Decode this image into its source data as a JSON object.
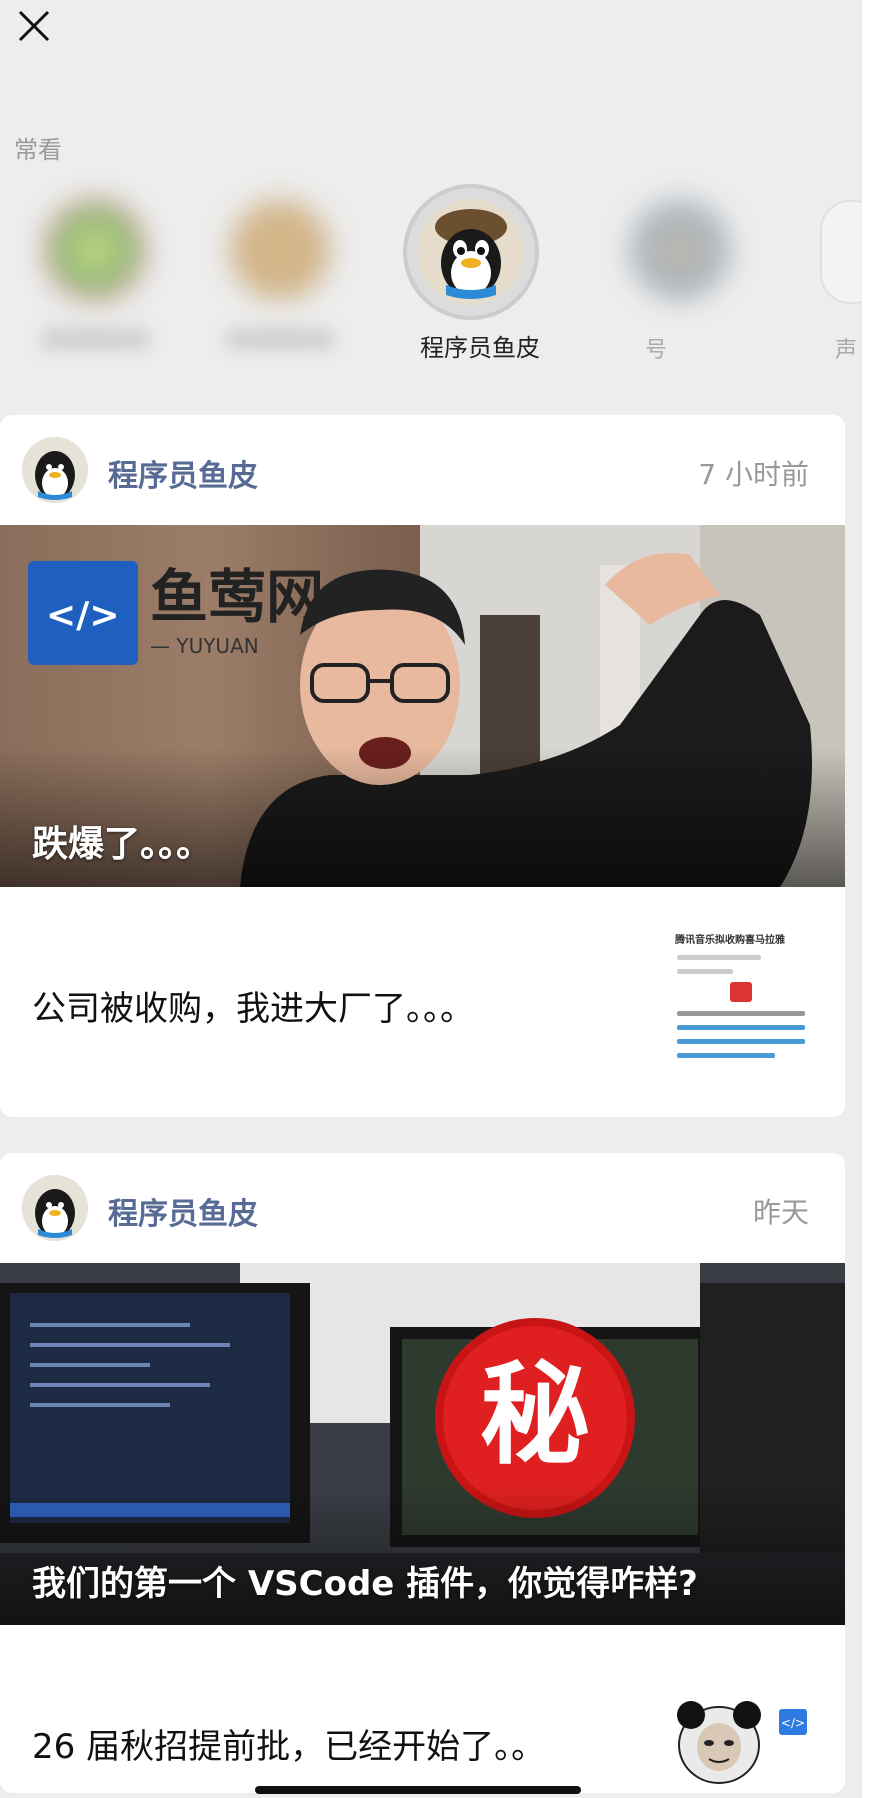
{
  "frequent": {
    "label": "常看",
    "active_name": "程序员鱼皮",
    "partial_names": [
      "号",
      "声"
    ]
  },
  "posts": [
    {
      "author": "程序员鱼皮",
      "time": "7 小时前",
      "hero_title": "跌爆了。。。",
      "hero_logo_text": "鱼莺网",
      "hero_logo_sub": "— YUYUAN",
      "sub_title": "公司被收购，我进大厂了。。。",
      "thumb_heading": "腾讯音乐拟收购喜马拉雅"
    },
    {
      "author": "程序员鱼皮",
      "time": "昨天",
      "hero_title": "我们的第一个 VSCode 插件，你觉得咋样?",
      "hero_badge": "秘",
      "sub_title": "26 届秋招提前批，已经开始了。。"
    }
  ],
  "colors": {
    "author": "#576b95",
    "background": "#ededed",
    "badge_red": "#e02020"
  }
}
